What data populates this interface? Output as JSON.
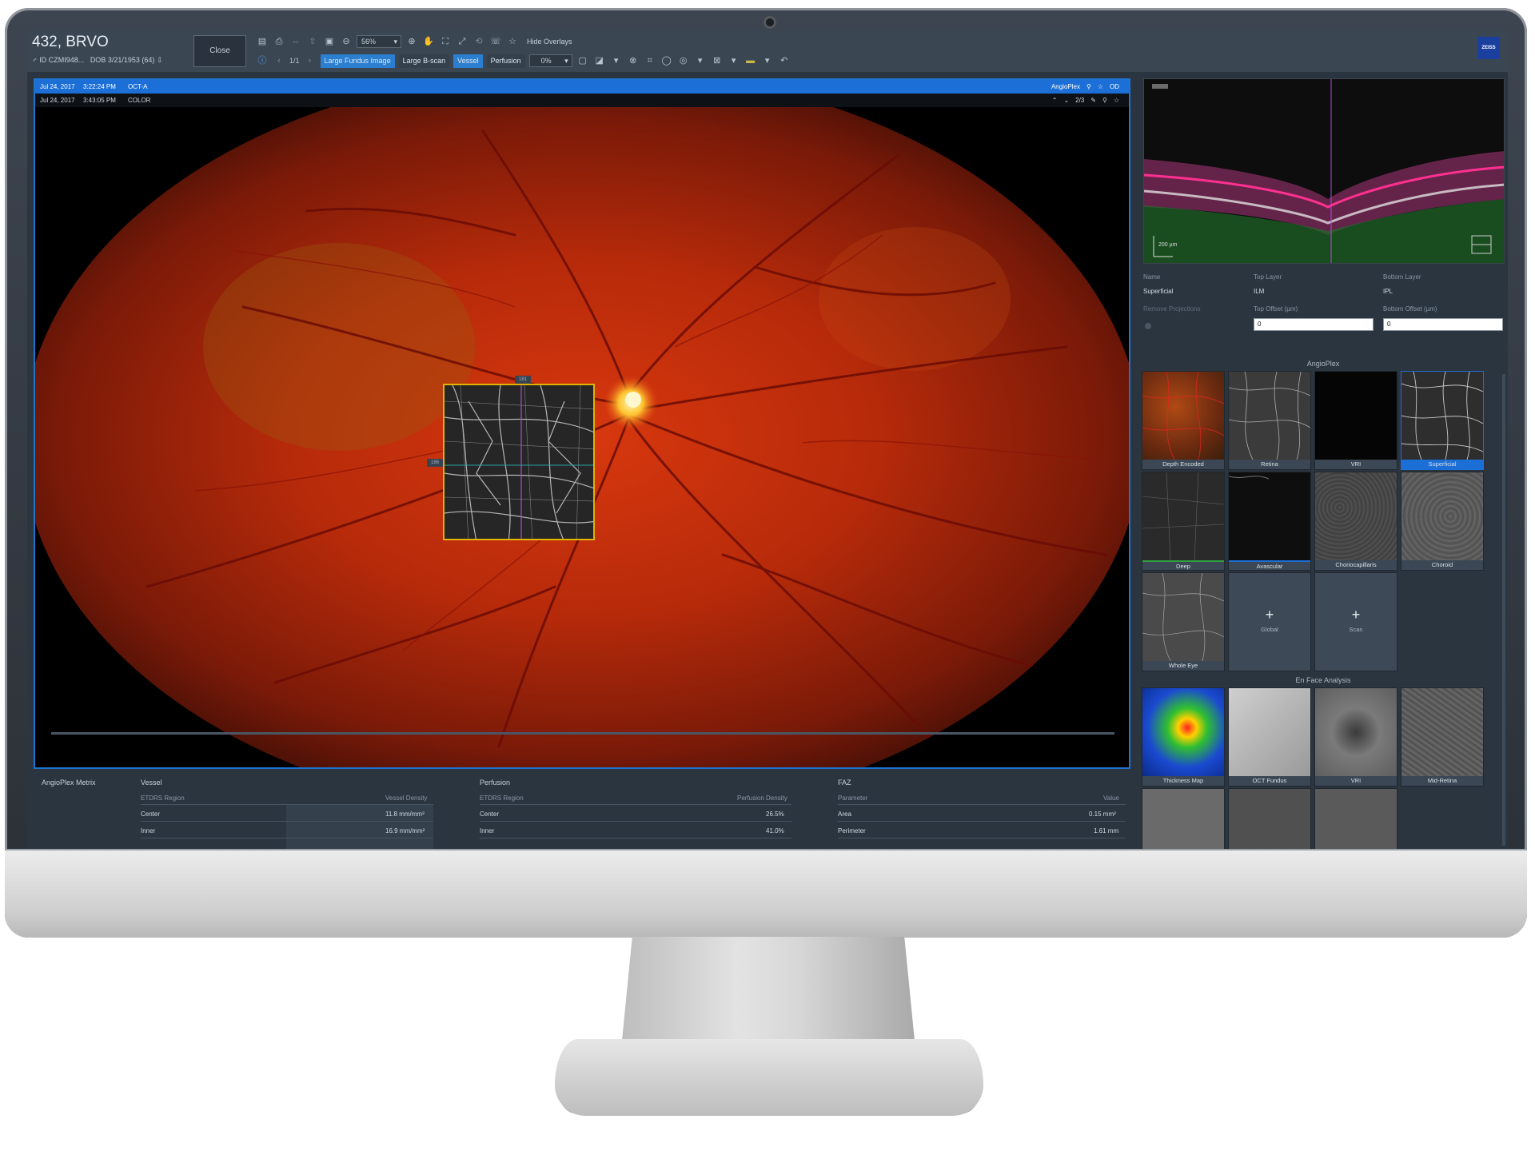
{
  "patient": {
    "name": "432, BRVO",
    "id_label": "ID",
    "id_value": "CZMI948...",
    "dob_label": "DOB",
    "dob_value": "3/21/1953",
    "age": "(64)"
  },
  "toolbar": {
    "close_label": "Close",
    "zoom_value": "56%",
    "page_counter": "1/1",
    "hide_overlays": "Hide Overlays",
    "large_fundus": "Large Fundus Image",
    "large_bscan": "Large B-scan",
    "vessel": "Vessel",
    "perfusion": "Perfusion",
    "opacity_value": "0%",
    "logo_text": "ZEISS"
  },
  "viewer": {
    "row1": {
      "date": "Jul 24, 2017",
      "time": "3:22:24 PM",
      "type": "OCT-A",
      "angioplex": "AngioPlex",
      "eye": "OD"
    },
    "row2": {
      "date": "Jul 24, 2017",
      "time": "3:43:05 PM",
      "type": "COLOR",
      "counter": "2/3"
    },
    "inset_top_tag": "181",
    "inset_left_tag": "186"
  },
  "metrics": {
    "title": "AngioPlex Metrix",
    "vessel": {
      "title": "Vessel",
      "col1": "ETDRS Region",
      "col2": "Vessel Density",
      "rows": [
        {
          "region": "Center",
          "value": "11.8 mm/mm²"
        },
        {
          "region": "Inner",
          "value": "16.9 mm/mm²"
        }
      ]
    },
    "perfusion": {
      "title": "Perfusion",
      "col1": "ETDRS Region",
      "col2": "Perfusion Density",
      "rows": [
        {
          "region": "Center",
          "value": "26.5%"
        },
        {
          "region": "Inner",
          "value": "41.0%"
        }
      ]
    },
    "faz": {
      "title": "FAZ",
      "col1": "Parameter",
      "col2": "Value",
      "rows": [
        {
          "region": "Area",
          "value": "0.15 mm²"
        },
        {
          "region": "Perimeter",
          "value": "1.61 mm"
        }
      ]
    }
  },
  "oct": {
    "scale_label": "200 µm"
  },
  "layers": {
    "name_label": "Name",
    "name_value": "Superficial",
    "top_layer_label": "Top Layer",
    "top_layer_value": "ILM",
    "bottom_layer_label": "Bottom Layer",
    "bottom_layer_value": "IPL",
    "remove_projections": "Remove Projections",
    "top_offset_label": "Top Offset (µm)",
    "top_offset_value": "0",
    "bottom_offset_label": "Bottom Offset (µm)",
    "bottom_offset_value": "0"
  },
  "angioplex": {
    "title": "AngioPlex",
    "thumbs": [
      "Depth Encoded",
      "Retina",
      "VRI",
      "Superficial",
      "Deep",
      "Avascular",
      "Choriocapillaris",
      "Choroid",
      "Whole Eye"
    ],
    "add_global": "Global",
    "add_scan": "Scan"
  },
  "enface": {
    "title": "En Face Analysis",
    "thumbs": [
      "Thickness Map",
      "OCT Fundus",
      "VRI",
      "Mid-Retina"
    ]
  }
}
